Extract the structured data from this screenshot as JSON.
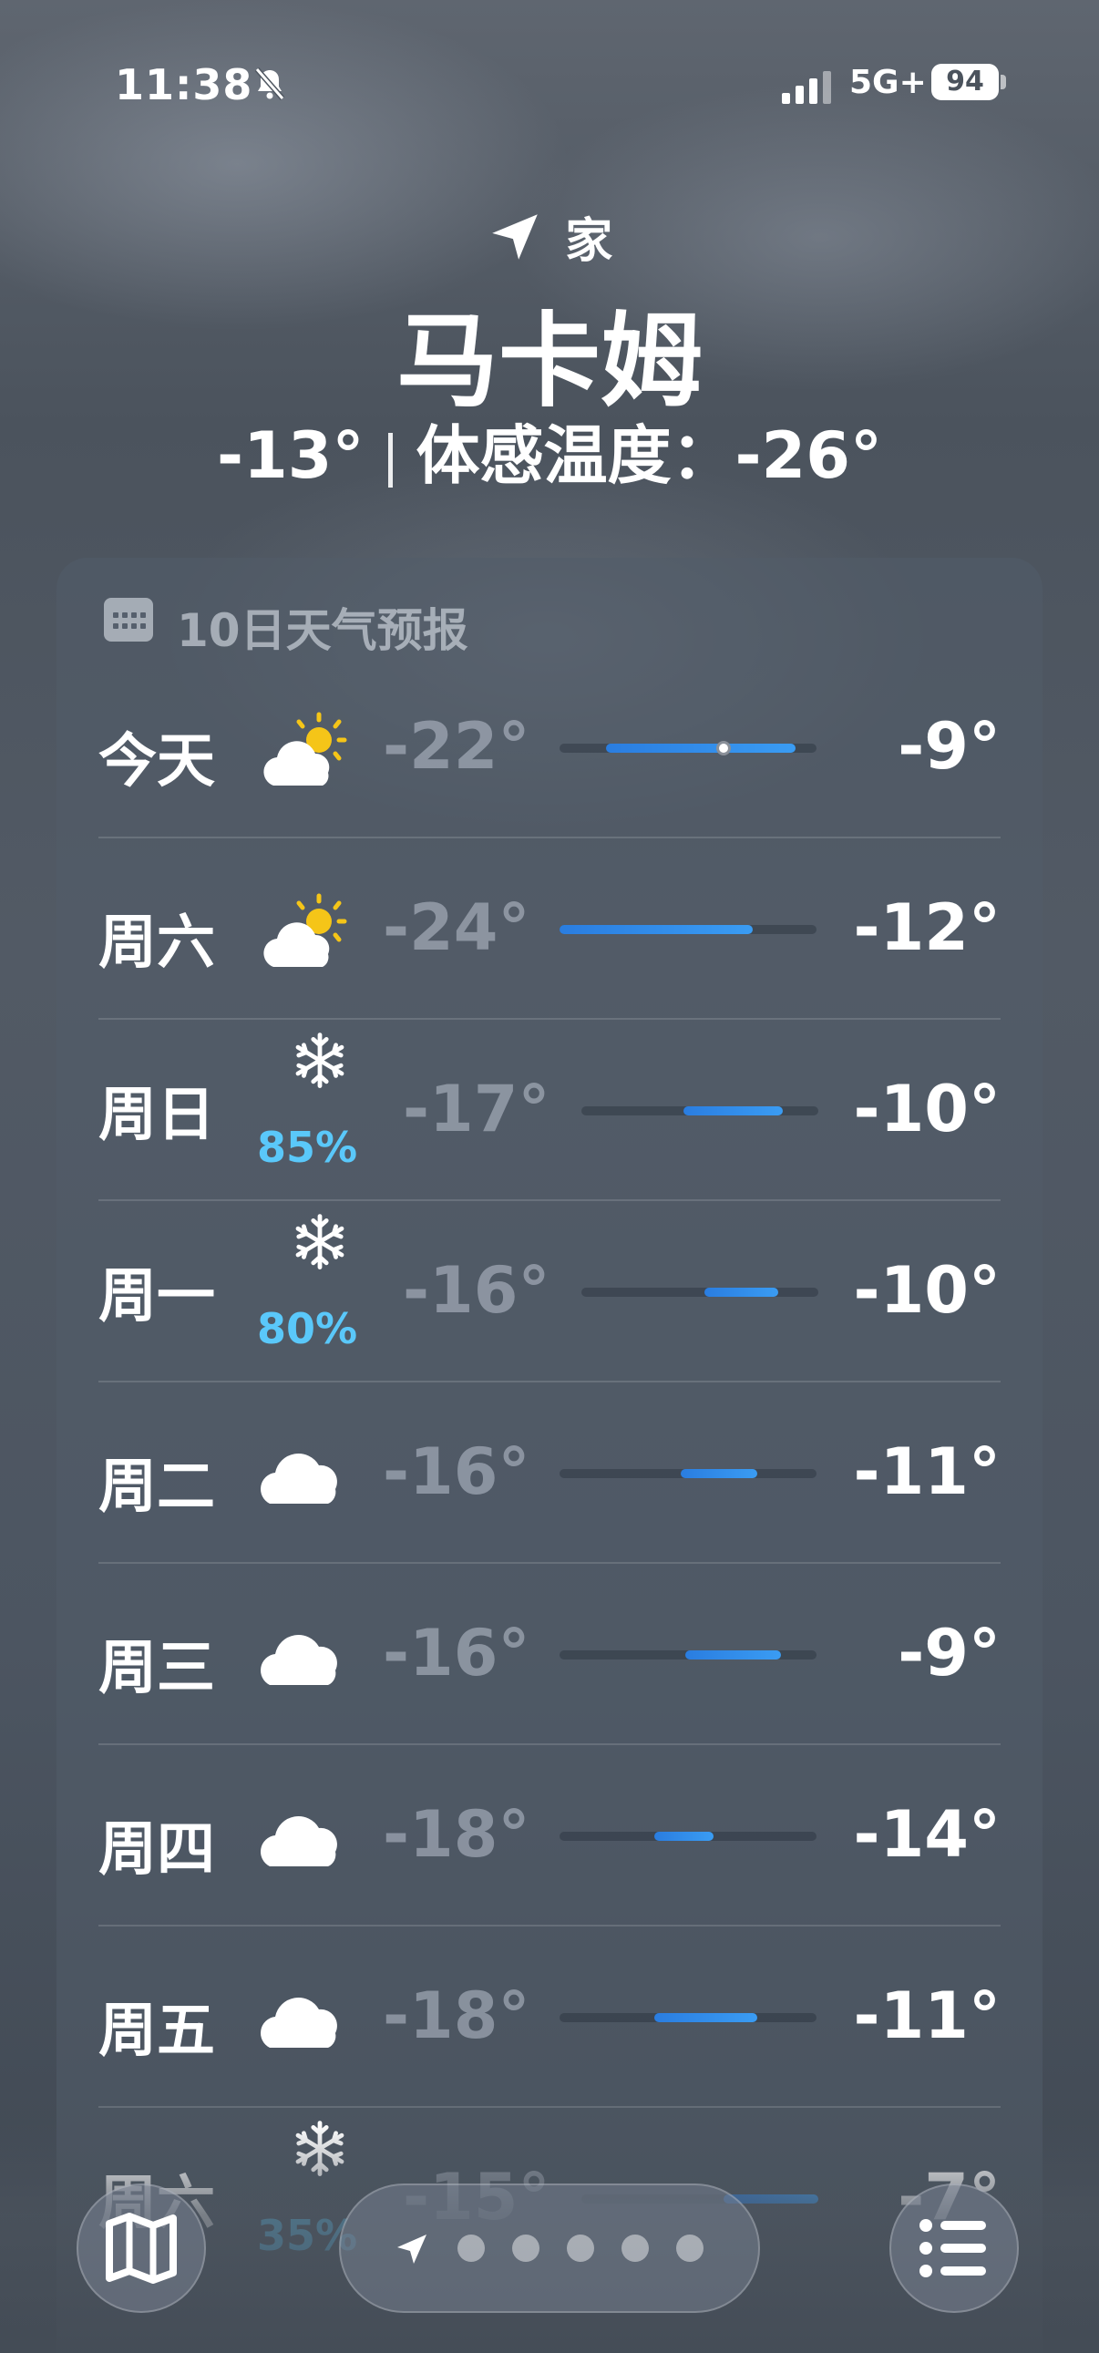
{
  "status_bar": {
    "time": "11:38",
    "network": "5G+",
    "battery": "94"
  },
  "header": {
    "location_label": "家",
    "city": "马卡姆",
    "current_temp": "-13°",
    "feels_like": "体感温度：-26°"
  },
  "forecast": {
    "title": "10日天气预报",
    "days": [
      {
        "day": "今天",
        "icon": "partly-cloudy-sun-icon",
        "precip": "",
        "low": "-22°",
        "high": "-9°",
        "range_start": 0.18,
        "range_end": 0.92,
        "current": 0.64
      },
      {
        "day": "周六",
        "icon": "partly-cloudy-sun-icon",
        "precip": "",
        "low": "-24°",
        "high": "-12°",
        "range_start": 0.0,
        "range_end": 0.75
      },
      {
        "day": "周日",
        "icon": "snowflake-icon",
        "precip": "85%",
        "low": "-17°",
        "high": "-10°",
        "range_start": 0.43,
        "range_end": 0.85
      },
      {
        "day": "周一",
        "icon": "snowflake-icon",
        "precip": "80%",
        "low": "-16°",
        "high": "-10°",
        "range_start": 0.52,
        "range_end": 0.83
      },
      {
        "day": "周二",
        "icon": "cloud-icon",
        "precip": "",
        "low": "-16°",
        "high": "-11°",
        "range_start": 0.47,
        "range_end": 0.77
      },
      {
        "day": "周三",
        "icon": "cloud-icon",
        "precip": "",
        "low": "-16°",
        "high": "-9°",
        "range_start": 0.49,
        "range_end": 0.86
      },
      {
        "day": "周四",
        "icon": "cloud-icon",
        "precip": "",
        "low": "-18°",
        "high": "-14°",
        "range_start": 0.37,
        "range_end": 0.6
      },
      {
        "day": "周五",
        "icon": "cloud-icon",
        "precip": "",
        "low": "-18°",
        "high": "-11°",
        "range_start": 0.37,
        "range_end": 0.77
      },
      {
        "day": "周六",
        "icon": "snowflake-icon",
        "precip": "35%",
        "low": "-15°",
        "high": "-7°",
        "range_start": 0.6,
        "range_end": 1.0
      }
    ]
  },
  "toolbar": {
    "page_count": 5,
    "active_page": "location"
  },
  "colors": {
    "precip": "#5ac8fa",
    "bar": "#2f8ae8",
    "sun": "#f5c518"
  }
}
